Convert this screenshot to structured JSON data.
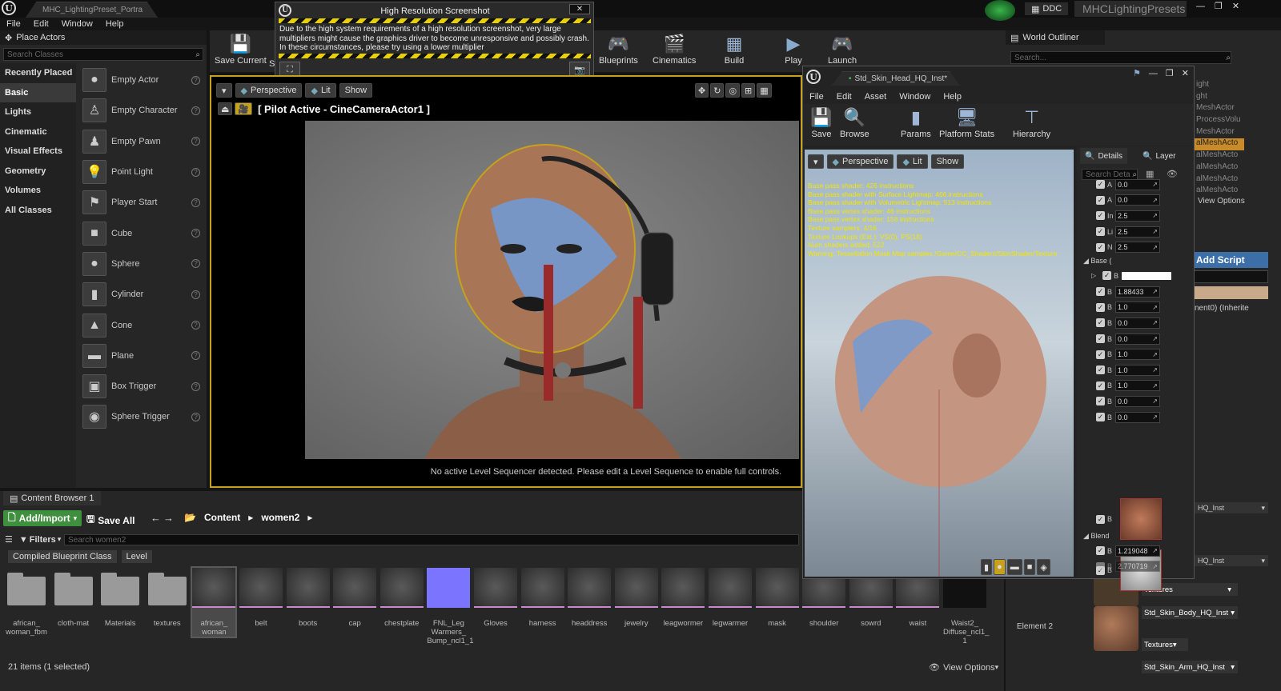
{
  "window": {
    "tab_title": "MHC_LightingPreset_Portra",
    "ddc_label": "DDC",
    "project_name": "MHCLightingPresets"
  },
  "menu": [
    "File",
    "Edit",
    "Window",
    "Help"
  ],
  "place_actors": {
    "title": "Place Actors",
    "search_placeholder": "Search Classes",
    "categories": [
      "Recently Placed",
      "Basic",
      "Lights",
      "Cinematic",
      "Visual Effects",
      "Geometry",
      "Volumes",
      "All Classes"
    ],
    "items": [
      {
        "label": "Empty Actor",
        "icon": "sphere-icon"
      },
      {
        "label": "Empty Character",
        "icon": "character-icon"
      },
      {
        "label": "Empty Pawn",
        "icon": "pawn-icon"
      },
      {
        "label": "Point Light",
        "icon": "lightbulb-icon"
      },
      {
        "label": "Player Start",
        "icon": "player-start-icon"
      },
      {
        "label": "Cube",
        "icon": "cube-icon"
      },
      {
        "label": "Sphere",
        "icon": "sphere-icon"
      },
      {
        "label": "Cylinder",
        "icon": "cylinder-icon"
      },
      {
        "label": "Cone",
        "icon": "cone-icon"
      },
      {
        "label": "Plane",
        "icon": "plane-icon"
      },
      {
        "label": "Box Trigger",
        "icon": "box-trigger-icon"
      },
      {
        "label": "Sphere Trigger",
        "icon": "sphere-trigger-icon"
      }
    ]
  },
  "toolbar": {
    "save_current": "Save Current",
    "save_current_cut": "S",
    "blueprints": "Blueprints",
    "cinematics": "Cinematics",
    "build": "Build",
    "play": "Play",
    "launch": "Launch"
  },
  "hires_dialog": {
    "title": "High Resolution Screenshot",
    "warning_line1": "Due to the high system requirements of a high resolution screenshot, very large",
    "warning_line2": "multipliers might cause the graphics driver to become unresponsive and possibly crash.",
    "warning_line3": "In these circumstances, please try using a lower multiplier"
  },
  "viewport": {
    "perspective": "Perspective",
    "lit": "Lit",
    "show": "Show",
    "pilot_label": "[ Pilot Active - CineCameraActor1 ]",
    "sequencer_notice": "No active Level Sequencer detected. Please edit a Level Sequence to enable full controls."
  },
  "content_browser": {
    "tab": "Content Browser 1",
    "add_import": "Add/Import",
    "save_all": "Save All",
    "path": [
      "Content",
      "women2"
    ],
    "filters": "Filters",
    "search_placeholder": "Search women2",
    "filter_chips": [
      "Compiled Blueprint Class",
      "Level"
    ],
    "items_status": "21 items (1 selected)",
    "view_options": "View Options",
    "assets": [
      {
        "label": "african_ woman_fbm",
        "kind": "folder"
      },
      {
        "label": "cloth-mat",
        "kind": "folder"
      },
      {
        "label": "Materials",
        "kind": "folder"
      },
      {
        "label": "textures",
        "kind": "folder"
      },
      {
        "label": "african_ woman",
        "kind": "mesh",
        "selected": true
      },
      {
        "label": "belt",
        "kind": "mesh"
      },
      {
        "label": "boots",
        "kind": "mesh"
      },
      {
        "label": "cap",
        "kind": "mesh"
      },
      {
        "label": "chestplate",
        "kind": "mesh"
      },
      {
        "label": "FNL_Leg Warmers_ Bump_ncl1_1",
        "kind": "texture"
      },
      {
        "label": "Gloves",
        "kind": "mesh"
      },
      {
        "label": "harness",
        "kind": "mesh"
      },
      {
        "label": "headdress",
        "kind": "mesh"
      },
      {
        "label": "jewelry",
        "kind": "mesh"
      },
      {
        "label": "leagwormer",
        "kind": "mesh"
      },
      {
        "label": "legwarmer",
        "kind": "mesh"
      },
      {
        "label": "mask",
        "kind": "mesh"
      },
      {
        "label": "shoulder",
        "kind": "mesh"
      },
      {
        "label": "sowrd",
        "kind": "mesh"
      },
      {
        "label": "waist",
        "kind": "mesh"
      },
      {
        "label": "Waist2_ Diffuse_ncl1_ 1",
        "kind": "texture"
      }
    ]
  },
  "world_outliner": {
    "title": "World Outliner",
    "search_placeholder": "Search...",
    "items": [
      "ight",
      "ght",
      "MeshActor",
      "ProcessVolu",
      "MeshActor",
      "alMeshActo",
      "alMeshActo",
      "alMeshActo",
      "alMeshActo",
      "alMeshActo"
    ],
    "view_options": "View Options"
  },
  "details_right": {
    "add_script": "Add Script",
    "inherited": "nent0) (Inherite",
    "element_label": "Element 2",
    "materials": [
      "HQ_Inst",
      "HQ_Inst",
      "Std_Skin_Body_HQ_Inst",
      "Std_Skin_Arm_HQ_Inst"
    ],
    "textures_label": "Textures"
  },
  "material_editor": {
    "tab_title": "Std_Skin_Head_HQ_Inst*",
    "menu": [
      "File",
      "Edit",
      "Asset",
      "Window",
      "Help"
    ],
    "toolbar": [
      "Save",
      "Browse",
      "Params",
      "Platform Stats",
      "Hierarchy"
    ],
    "viewport": {
      "perspective": "Perspective",
      "lit": "Lit",
      "show": "Show"
    },
    "stats": [
      "Base pass shader: 426 instructions",
      "Base pass shader with Surface Lightmap: 466 instructions",
      "Base pass shader with Volumetric Lightmap: 513 instructions",
      "Base pass vertex shader: 46 instructions",
      "Base pass vertex shader: 158 instructions",
      "Texture samplers: 4/16",
      "Texture Lookups (Est.): VS(0), PS(18)",
      "Num shaders added: 522",
      "Warning: Tessellation Mask Map samples /Game/CC_Shaders/SkinShader/Texture"
    ],
    "details_tab": "Details",
    "layer_tab": "Layer",
    "search_placeholder": "Search Deta",
    "rows_top": [
      {
        "label": "A",
        "value": "0.0"
      },
      {
        "label": "A",
        "value": "0.0"
      },
      {
        "label": "In",
        "value": "2.5"
      },
      {
        "label": "Li",
        "value": "2.5"
      },
      {
        "label": "N",
        "value": "2.5"
      }
    ],
    "base_section": "Base (",
    "rows_base": [
      {
        "label": "B",
        "value": "1.88433"
      },
      {
        "label": "B",
        "value": "1.0"
      },
      {
        "label": "B",
        "value": "0.0"
      },
      {
        "label": "B",
        "value": "0.0"
      },
      {
        "label": "B",
        "value": "1.0"
      },
      {
        "label": "B",
        "value": "1.0"
      },
      {
        "label": "B",
        "value": "1.0"
      },
      {
        "label": "B",
        "value": "0.0"
      },
      {
        "label": "B",
        "value": "0.0"
      }
    ],
    "tex_labels": [
      "B",
      "B"
    ],
    "blend_section": "Blend",
    "rows_blend": [
      {
        "label": "B",
        "value": "1.219048"
      },
      {
        "label": "B",
        "value": "2.770719"
      }
    ]
  }
}
